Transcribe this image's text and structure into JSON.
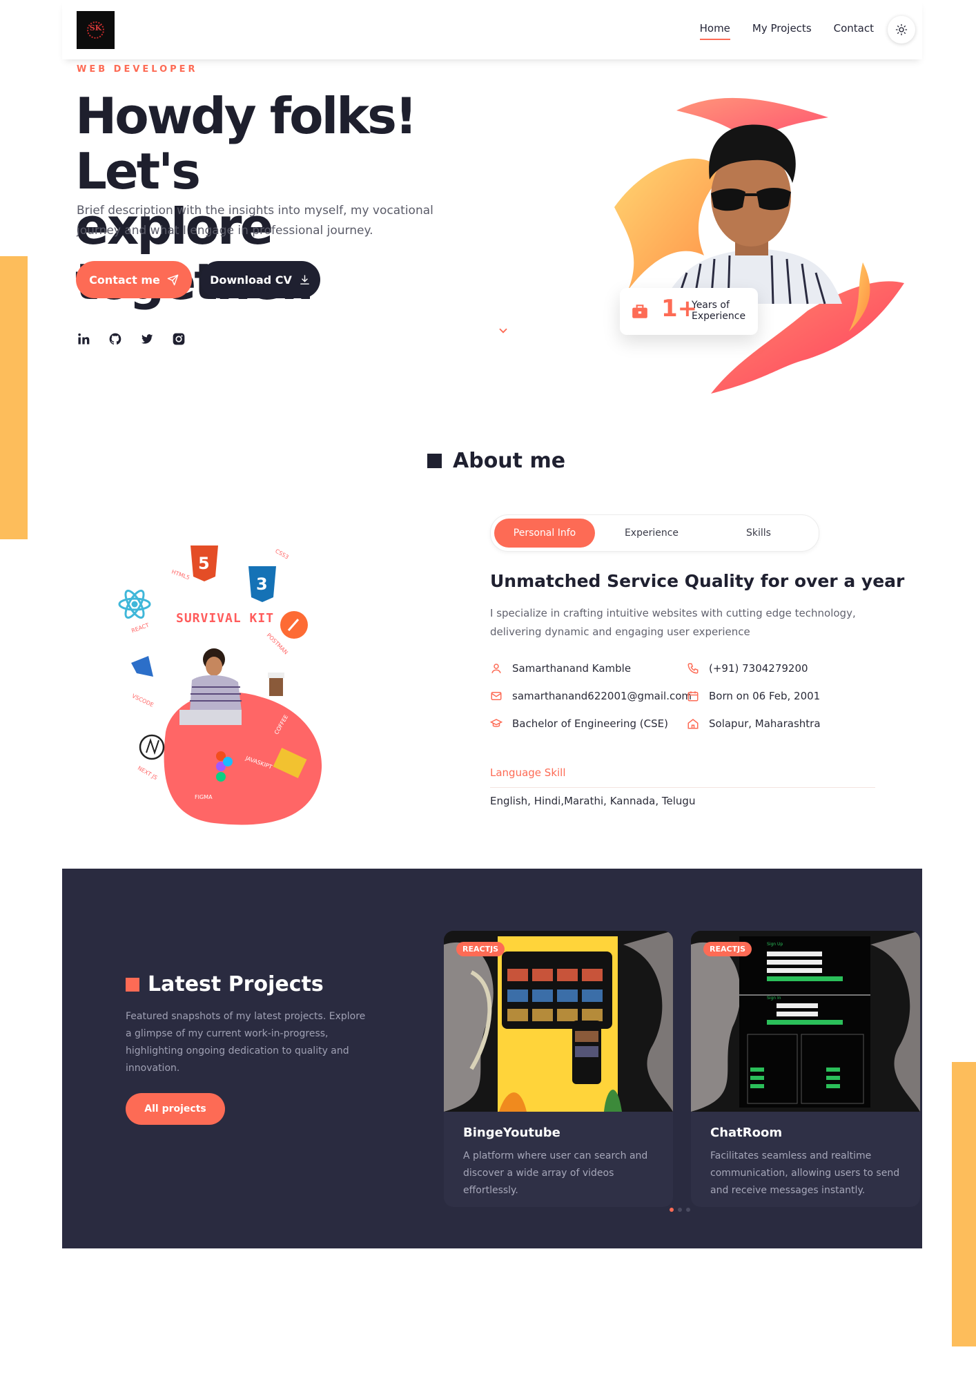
{
  "header": {
    "logo_alt": "logo",
    "logo_text": "SK",
    "nav": [
      {
        "label": "Home",
        "active": true
      },
      {
        "label": "My Projects",
        "active": false
      },
      {
        "label": "Contact",
        "active": false
      }
    ],
    "theme_icon": "sun-icon"
  },
  "hero": {
    "eyebrow": "WEB DEVELOPER",
    "title_line1": "Howdy folks! Let's",
    "title_line2": "explore together.",
    "description": "Brief description with the insights into myself, my vocational journey and what I engage in professional journey.",
    "contact_button": "Contact me",
    "cv_button": "Download CV",
    "socials": [
      "linkedin-icon",
      "github-icon",
      "twitter-icon",
      "instagram-icon"
    ],
    "experience": {
      "value": "1+",
      "label": "Years of Experience"
    }
  },
  "about": {
    "title": "About me",
    "illustration_title": "SURVIVAL KIT",
    "illustration_labels": [
      "HTML5",
      "CSS3",
      "REACT",
      "POSTMAN",
      "VSCODE",
      "COFFEE",
      "NEXT JS",
      "JAVASKIPT",
      "FIGMA"
    ],
    "tabs": [
      {
        "label": "Personal Info",
        "active": true
      },
      {
        "label": "Experience",
        "active": false
      },
      {
        "label": "Skills",
        "active": false
      }
    ],
    "heading": "Unmatched Service Quality for over a year",
    "description": "I specialize in crafting intuitive websites with cutting edge technology, delivering dynamic and engaging user experience",
    "info": {
      "name": "Samarthanand Kamble",
      "phone": "(+91) 7304279200",
      "email": "samarthanand622001@gmail.com",
      "dob": "Born on 06 Feb, 2001",
      "degree": "Bachelor of Engineering (CSE)",
      "location": "Solapur, Maharashtra"
    },
    "language_label": "Language Skill",
    "languages": "English, Hindi,Marathi, Kannada, Telugu"
  },
  "projects": {
    "title": "Latest Projects",
    "description": "Featured snapshots of my latest projects. Explore a glimpse of my current work-in-progress, highlighting ongoing dedication to quality and innovation.",
    "all_button": "All projects",
    "cards": [
      {
        "tag": "REACTJS",
        "title": "BingeYoutube",
        "description": "A platform where user can search and discover a wide array of videos effortlessly."
      },
      {
        "tag": "REACTJS",
        "title": "ChatRoom",
        "description": "Facilitates seamless and realtime communication, allowing users to send and receive messages instantly."
      }
    ],
    "chatroom_screen": {
      "signup": "Sign Up",
      "signin": "Sign In"
    }
  },
  "colors": {
    "accent": "#fd6b55",
    "dark": "#1f2030",
    "section_bg": "#2a2b40",
    "deco": "#fdbd5b"
  }
}
